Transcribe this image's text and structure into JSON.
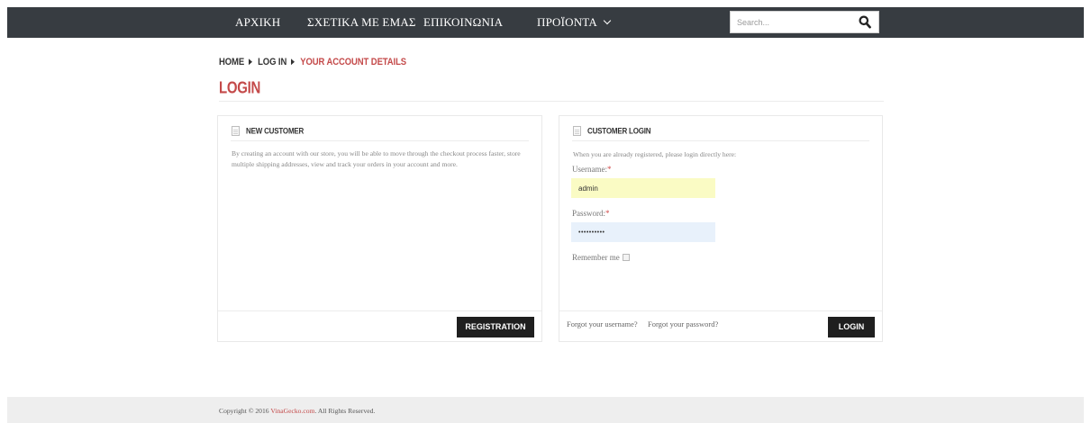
{
  "nav": {
    "items": [
      {
        "label": "ΑΡΧΙΚΗ"
      },
      {
        "label": "ΣΧΕΤΙΚΑ ΜΕ ΕΜΑΣ"
      },
      {
        "label": "ΕΠΙΚΟΙΝΩΝΙΑ"
      },
      {
        "label": "ΠΡΟΪΟΝΤΑ"
      }
    ],
    "search_placeholder": "Search...",
    "search_icon": "search-icon"
  },
  "breadcrumb": {
    "home": "HOME",
    "login": "LOG IN",
    "current": "YOUR ACCOUNT DETAILS"
  },
  "page_title": "LOGIN",
  "new_customer": {
    "heading": "NEW CUSTOMER",
    "text": "By creating an account with our store, you will be able to move through the checkout process faster, store multiple shipping addresses, view and track your orders in your account and more.",
    "button": "REGISTRATION"
  },
  "customer_login": {
    "heading": "CUSTOMER LOGIN",
    "intro": "When you are already registered, please login directly here:",
    "username_label": "Username:",
    "username_value": "admin",
    "password_label": "Password:",
    "password_value": "••••••••••",
    "required_mark": "*",
    "remember_label": "Remember me",
    "forgot_username": "Forgot your username?",
    "forgot_password": "Forgot your password?",
    "button": "LOGIN"
  },
  "footer": {
    "prefix": "Copyright © 2016 ",
    "brand": "VinaGecko.com",
    "suffix": ". All Rights Reserved."
  },
  "colors": {
    "nav_bg": "#373c41",
    "accent": "#c44a4a",
    "button_bg": "#1f1f1f",
    "username_bg": "#fafbc4",
    "password_bg": "#e8f1fb",
    "footer_bg": "#eeeeee"
  }
}
